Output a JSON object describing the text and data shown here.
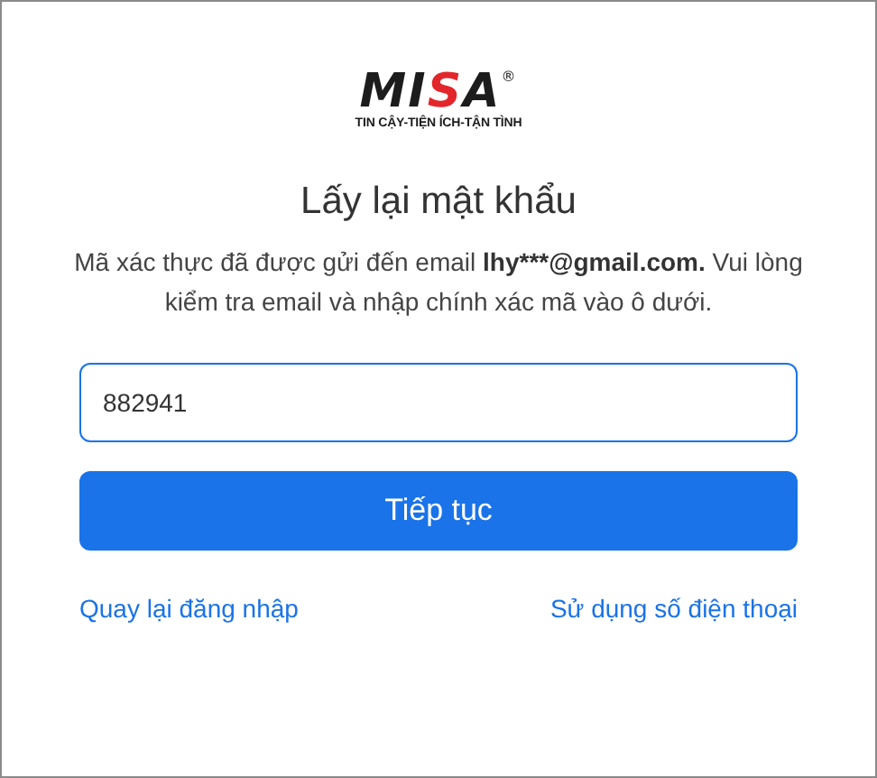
{
  "logo": {
    "letters": [
      {
        "text": "MI",
        "color": "#1c1c1c"
      },
      {
        "text": "S",
        "color": "#e3262b"
      },
      {
        "text": "A",
        "color": "#1c1c1c"
      }
    ],
    "mark": "®",
    "tagline": "TIN CẬY-TIỆN ÍCH-TẬN TÌNH"
  },
  "title": "Lấy lại mật khẩu",
  "message": {
    "before": "Mã xác thực đã được gửi đến email ",
    "email": "lhy***@gmail.com.",
    "after": " Vui lòng kiểm tra email và nhập chính xác mã vào ô dưới."
  },
  "code_field": {
    "value": "882941",
    "focused": true
  },
  "submit_button": "Tiếp tục",
  "links": [
    "Quay lại đăng nhập",
    "Sử dụng số điện thoại"
  ]
}
